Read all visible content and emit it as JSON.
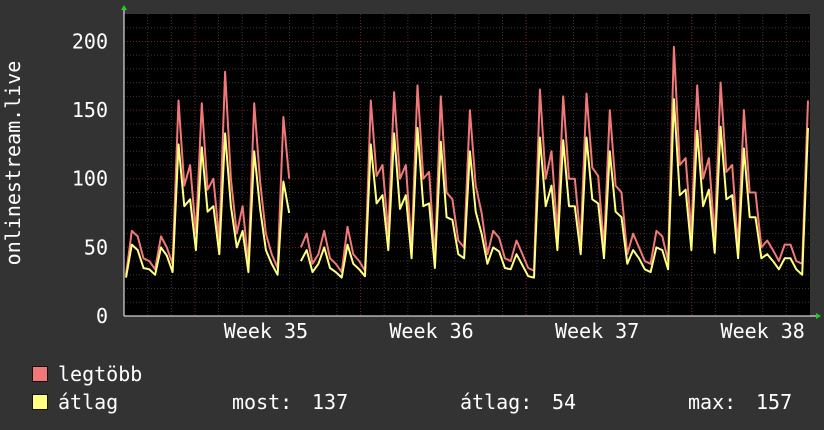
{
  "chart_data": {
    "type": "line",
    "ylabel": "onlinestream.live",
    "ylim": [
      0,
      220
    ],
    "yticks": [
      0,
      50,
      100,
      150,
      200
    ],
    "xticks": [
      "Week 35",
      "Week 36",
      "Week 37",
      "Week 38"
    ],
    "x_range_days": [
      0,
      29
    ],
    "xtick_days": [
      6,
      13,
      20,
      27
    ],
    "grid": true,
    "legend_position": "bottom-left",
    "series": [
      {
        "name": "legtöbb",
        "color": "#f07878",
        "values": [
          30,
          62,
          58,
          42,
          40,
          34,
          58,
          50,
          38,
          157,
          95,
          110,
          60,
          155,
          92,
          100,
          55,
          178,
          100,
          60,
          80,
          38,
          155,
          98,
          60,
          45,
          35,
          145,
          100,
          null,
          50,
          60,
          38,
          45,
          62,
          42,
          38,
          32,
          65,
          45,
          40,
          33,
          157,
          102,
          110,
          60,
          163,
          100,
          110,
          50,
          168,
          100,
          105,
          42,
          160,
          90,
          85,
          55,
          50,
          150,
          95,
          75,
          45,
          62,
          57,
          42,
          40,
          55,
          45,
          35,
          33,
          165,
          100,
          120,
          60,
          160,
          100,
          100,
          55,
          162,
          108,
          102,
          50,
          150,
          95,
          90,
          45,
          60,
          50,
          40,
          38,
          62,
          58,
          40,
          196,
          110,
          115,
          60,
          168,
          100,
          115,
          57,
          170,
          105,
          110,
          50,
          150,
          90,
          90,
          50,
          55,
          48,
          40,
          52,
          52,
          40,
          38,
          157
        ]
      },
      {
        "name": "átlag",
        "color": "#ffff80",
        "values": [
          28,
          52,
          48,
          35,
          34,
          30,
          50,
          44,
          32,
          125,
          80,
          85,
          48,
          123,
          76,
          80,
          45,
          133,
          80,
          50,
          62,
          32,
          120,
          78,
          48,
          38,
          30,
          98,
          75,
          null,
          40,
          48,
          32,
          38,
          50,
          35,
          32,
          28,
          52,
          38,
          34,
          29,
          125,
          82,
          88,
          48,
          133,
          78,
          88,
          42,
          137,
          80,
          82,
          35,
          127,
          72,
          70,
          45,
          42,
          120,
          76,
          60,
          38,
          50,
          47,
          35,
          34,
          45,
          37,
          29,
          28,
          130,
          80,
          95,
          48,
          128,
          80,
          80,
          45,
          130,
          85,
          82,
          42,
          120,
          76,
          72,
          38,
          48,
          42,
          34,
          32,
          50,
          48,
          34,
          158,
          88,
          92,
          48,
          135,
          80,
          92,
          46,
          138,
          85,
          88,
          42,
          122,
          72,
          72,
          42,
          45,
          40,
          34,
          42,
          42,
          34,
          30,
          137
        ]
      }
    ]
  },
  "legend": {
    "items": [
      {
        "label": "legtöbb",
        "color": "#f07878"
      },
      {
        "label": "átlag",
        "color": "#ffff80"
      }
    ]
  },
  "stats": {
    "now_label": "most:",
    "now_value": "137",
    "avg_label": "átlag:",
    "avg_value": "54",
    "max_label": "max:",
    "max_value": "157"
  }
}
